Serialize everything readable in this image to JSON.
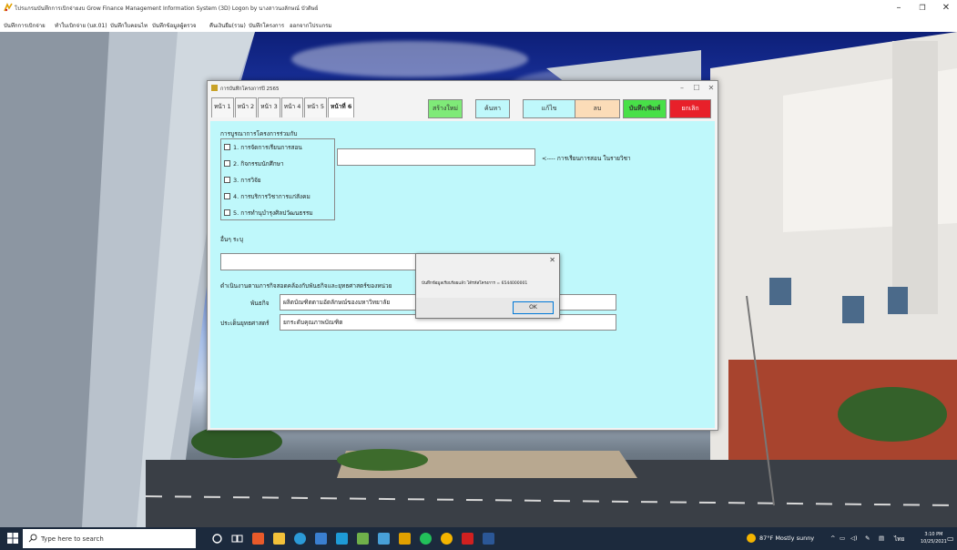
{
  "app": {
    "title": "โปรแกรมบันทึกการเบิกจ่ายงบ Grow Finance Management Information System (3D) Logon by นางสาวนงลักษณ์ บัวดิษย์",
    "menu": [
      "บันทึกการเบิกจ่าย",
      "ทำใบเบิกจ่าย (บส.01)",
      "บันทึกใบคอนไท",
      "บันทึกข้อมูลผู้ตรวจ",
      "คืนเงินยืม(รวม)",
      "บันทึกโครงการ",
      "ออกจากโปรแกรม"
    ]
  },
  "dialog": {
    "title": "การบันทึกโครงการปี 2565",
    "tabs": [
      "หน้า 1",
      "หน้า 2",
      "หน้า 3",
      "หน้า 4",
      "หน้า 5",
      "หน้าที่ 6"
    ],
    "buttons": {
      "create": "สร้างใหม่",
      "search": "ค้นหา",
      "edit": "แก้ไข",
      "delete": "ลบ",
      "save_print": "บันทึก/พิมพ์",
      "cancel": "ยกเลิก"
    },
    "integration_label": "การบูรณาการโครงการร่วมกับ",
    "checkboxes": [
      "1. การจัดการเรียนการสอน",
      "2. กิจกรรมนักศึกษา",
      "3. การวิจัย",
      "4. การบริการวิชาการแก่สังคม",
      "5. การทำนุบำรุงศิลปวัฒนธรรม"
    ],
    "course_hint": "<---- การเรียนการสอน ในรายวิชา",
    "other_label": "อื่นๆ ระบุ",
    "mission_intro": "ดำเนินงานตามภารกิจสอดคล้องกับพันธกิจและยุทธศาสตร์ของหน่วย",
    "mission_label": "พันธกิจ",
    "mission_value": "ผลิตบัณฑิตตามอัตลักษณ์ของมหาวิทยาลัย",
    "strategy_label": "ประเด็นยุทธศาสตร์",
    "strategy_value": "ยกระดับคุณภาพบัณฑิต"
  },
  "message_box": {
    "text": "บันทึกข้อมูลเรียบร้อยแล้ว ได้รหัสโครงการ = 6544000001",
    "ok": "OK"
  },
  "taskbar": {
    "search_placeholder": "Type here to search",
    "weather": "87°F  Mostly sunny",
    "time": "3:10 PM",
    "date": "10/25/2021",
    "lang": "ไทย"
  },
  "colors": {
    "content_bg": "#bff8fb",
    "btn_create": "#7fea78",
    "btn_search": "#bff8fb",
    "btn_edit": "#bff8fb",
    "btn_delete": "#fbdcb8",
    "btn_save": "#48e048",
    "btn_cancel": "#e8202a"
  }
}
